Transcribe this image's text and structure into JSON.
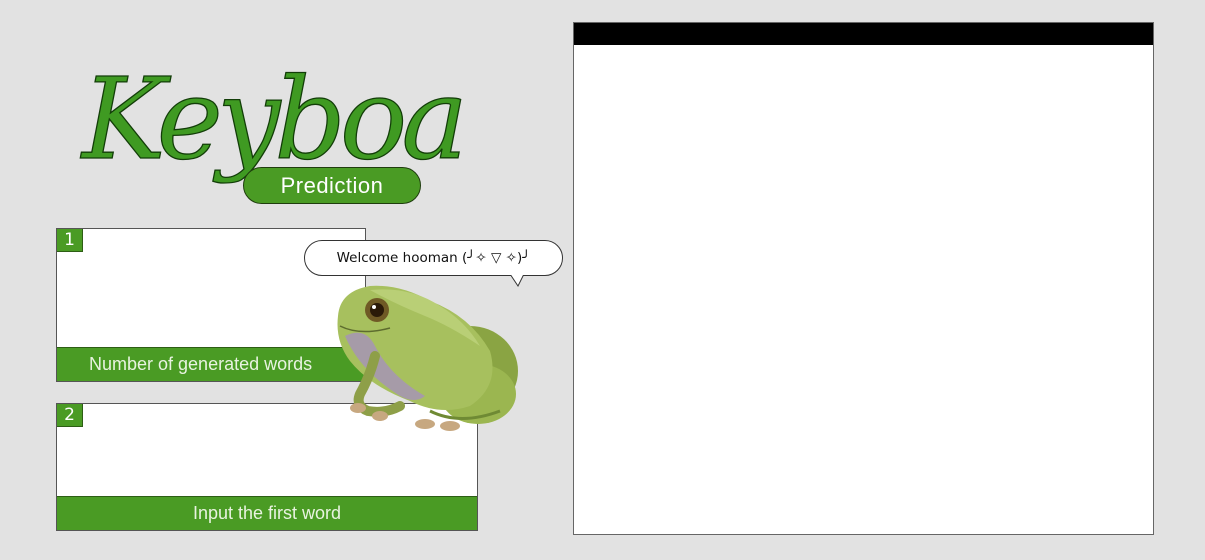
{
  "logo": {
    "title": "Keyboard",
    "subtitle": "Prediction"
  },
  "panels": [
    {
      "number": "1",
      "label": "Number of generated words",
      "value": ""
    },
    {
      "number": "2",
      "label": "Input the first word",
      "value": ""
    }
  ],
  "mascot": {
    "speech": "Welcome hooman (╯✧ ▽ ✧)╯"
  },
  "output": {
    "text": ""
  },
  "colors": {
    "accent_green": "#4a9b24",
    "background": "#e2e2e2",
    "titlebar": "#000000"
  }
}
